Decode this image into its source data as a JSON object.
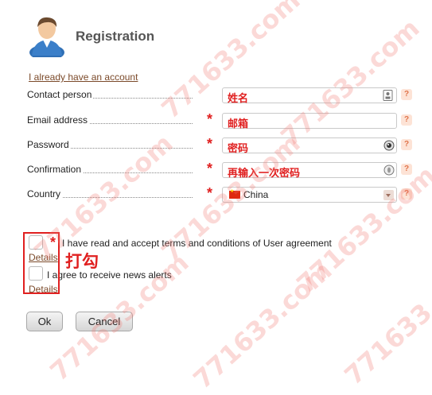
{
  "header": {
    "title": "Registration",
    "avatar_icon": "user-avatar-icon"
  },
  "account_link": "I already have an account",
  "fields": [
    {
      "label": "Contact person",
      "value": "姓名",
      "required": false,
      "icon": "id-card-icon"
    },
    {
      "label": "Email address",
      "value": "邮箱",
      "required": true,
      "icon": ""
    },
    {
      "label": "Password",
      "value": "密码",
      "required": true,
      "icon": "password-eye-icon"
    },
    {
      "label": "Confirmation",
      "value": "再输入一次密码",
      "required": true,
      "icon": "password-eye-icon"
    },
    {
      "label": "Country",
      "value": "China",
      "required": true,
      "icon": "chevron-down-icon"
    }
  ],
  "help_label": "?",
  "required_mark": "*",
  "agreements": [
    {
      "text": "I have read and accept terms and conditions of User agreement",
      "required": true,
      "details": "Details"
    },
    {
      "text": "I agree to receive news alerts",
      "required": false,
      "details": "Details"
    }
  ],
  "annotation": "打勾",
  "buttons": {
    "ok": "Ok",
    "cancel": "Cancel"
  },
  "watermark": "771633.com",
  "colors": {
    "required": "#e02020",
    "link": "#7b4a2a",
    "help_bg": "#fde3d6",
    "annotation": "#e02020"
  }
}
